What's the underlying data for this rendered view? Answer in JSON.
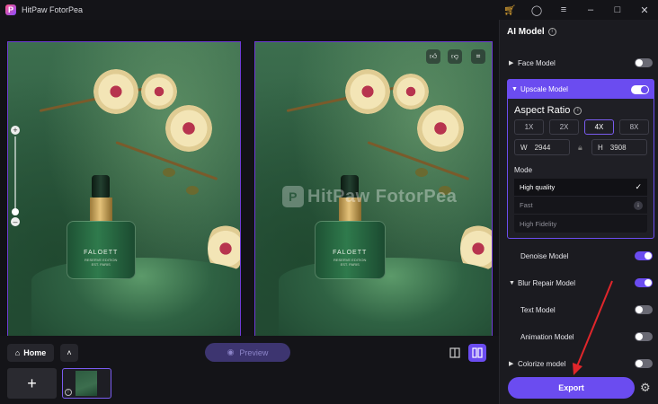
{
  "app": {
    "title": "HitPaw FotorPea",
    "logo_letter": "P"
  },
  "titlebar_icons": [
    "cart-icon",
    "user-icon",
    "menu-icon",
    "minimize-icon",
    "maximize-icon",
    "close-icon"
  ],
  "images": {
    "bottle_label": "FALOETT",
    "bottle_sub": "RESERVE EDITION\nEST. PARIS",
    "watermark": "HitPaw FotorPea"
  },
  "bottom": {
    "home": "Home",
    "preview": "Preview"
  },
  "panel": {
    "title": "AI Model",
    "face_model": "Face Model",
    "upscale_model": "Upscale Model",
    "aspect_ratio": "Aspect Ratio",
    "ratios": [
      "1X",
      "2X",
      "4X",
      "8X"
    ],
    "selected_ratio": "4X",
    "width_label": "W",
    "width_value": "2944",
    "height_label": "H",
    "height_value": "3908",
    "mode_label": "Mode",
    "modes": [
      "High quality",
      "Fast",
      "High Fidelity"
    ],
    "selected_mode": "High quality",
    "denoise_model": "Denoise Model",
    "blur_repair_model": "Blur Repair Model",
    "text_model": "Text Model",
    "animation_model": "Animation Model",
    "colorize_model": "Colorize model",
    "export": "Export"
  },
  "toggles": {
    "face_model": false,
    "upscale_model": true,
    "denoise_model": true,
    "blur_repair_model": true,
    "text_model": false,
    "animation_model": false,
    "colorize_model": false
  },
  "colors": {
    "accent": "#6b4cf0",
    "annotation_arrow": "#e0262b"
  }
}
